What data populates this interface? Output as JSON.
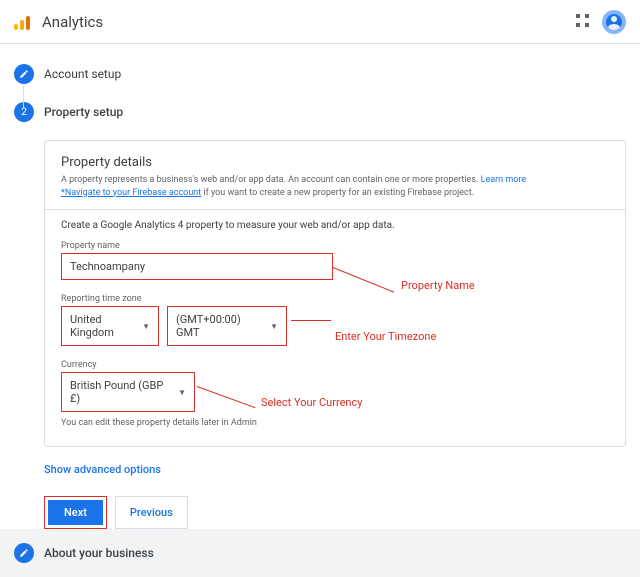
{
  "header": {
    "title": "Analytics"
  },
  "steps": {
    "account": "Account setup",
    "property": "Property setup",
    "number_property": "2",
    "about": "About your business"
  },
  "card": {
    "title": "Property details",
    "desc_prefix": "A property represents a business's web and/or app data. An account can contain one or more properties. ",
    "learn_more": "Learn more",
    "navigate": "*Navigate to your Firebase account",
    "desc_suffix": " if you want to create a new property for an existing Firebase project.",
    "instruction": "Create a Google Analytics 4 property to measure your web and/or app data.",
    "field_prop_label": "Property name",
    "field_prop_value": "Technoampany",
    "field_tz_label": "Reporting time zone",
    "field_tz_country": "United Kingdom",
    "field_tz_offset": "(GMT+00:00) GMT",
    "field_curr_label": "Currency",
    "field_curr_value": "British Pound (GBP £)",
    "edit_note": "You can edit these property details later in Admin"
  },
  "advanced": "Show advanced options",
  "btns": {
    "next": "Next",
    "prev": "Previous"
  },
  "annot": {
    "prop": "Property Name",
    "tz": "Enter Your Timezone",
    "curr": "Select Your Currency"
  }
}
